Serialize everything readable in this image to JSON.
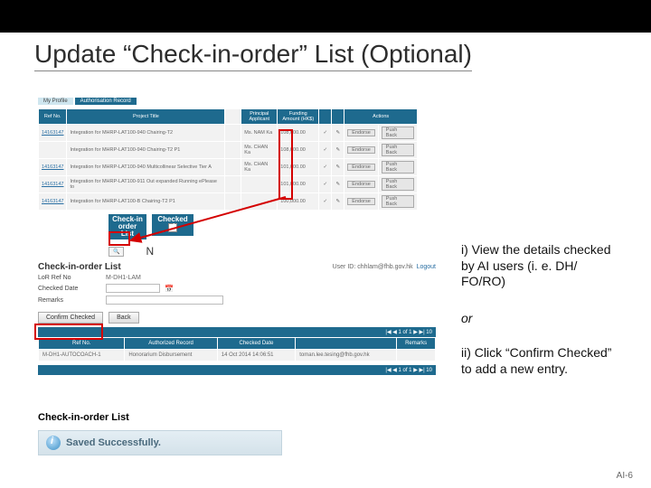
{
  "title": "Update “Check-in-order” List (Optional)",
  "app1": {
    "tabs": [
      "My Profile",
      "Authorisation Record"
    ],
    "headers": [
      "Ref No.",
      "Project Title",
      "Principal Applicant",
      "Funding Amount (HK$)",
      "",
      "",
      "Actions",
      ""
    ],
    "rows": [
      {
        "ref": "14163147",
        "title": "Integration for MHRP-LAT100-940 Chairing-T2",
        "pa": "Ms. NAM Ka",
        "amt": "108,000.00",
        "a1": "Endorse",
        "a2": "Push Back"
      },
      {
        "ref": "",
        "title": "Integration for MHRP-LAT100-940 Chairing-T2 P1",
        "pa": "Ms. CHAN Ka",
        "amt": "108,000.00",
        "a1": "Endorse",
        "a2": "Push Back"
      },
      {
        "ref": "14163147",
        "title": "Integration for MHRP-LAT100-940 Multicollinear Selective Tier A",
        "pa": "Ms. CHAN Ka",
        "amt": "101,000.00",
        "a1": "Endorse",
        "a2": "Push Back"
      },
      {
        "ref": "14163147",
        "title": "Integration for MHRP-LAT100-911 Out expanded Running ePlease to",
        "pa": "",
        "amt": "101,000.00",
        "a1": "Endorse",
        "a2": "Push Back"
      },
      {
        "ref": "14163147",
        "title": "Integration for MHRP-LAT100-B Chairing-T2 P1",
        "pa": "",
        "amt": "100,000.00",
        "a1": "Endorse",
        "a2": "Push Back"
      }
    ],
    "checkin_label": "Check-in order List",
    "checked_label": "Checked",
    "magnify": "🔍",
    "N": "N"
  },
  "app2": {
    "heading": "Check-in-order List",
    "user_prefix": "User ID:",
    "user": "chhlam@fhb.gov.hk",
    "logout": "Logout",
    "lbl_ref": "LoR Ref No",
    "val_ref": "M-DH1-LAM",
    "lbl_date": "Checked Date",
    "lbl_remarks": "Remarks",
    "btn_confirm": "Confirm Checked",
    "btn_back": "Back",
    "pager": "|◀ ◀   1 of 1   ▶ ▶|     10",
    "headers": [
      "Ref No.",
      "Authorized Record",
      "Checked Date",
      "",
      "Remarks"
    ],
    "row": {
      "ref": "M-DH1-AUTOCOACH-1",
      "auth": "Honorarium Disbursement",
      "date": "14 Oct 2014 14:06:51",
      "by": "toman.lee.tesing@fhb.gov.hk",
      "rem": ""
    }
  },
  "app3": {
    "heading": "Check-in-order List",
    "saved": "Saved Successfully."
  },
  "instr": {
    "i1": "i) View the details checked by AI users (i. e. DH/ FO/RO)",
    "or": "or",
    "i2": "ii) Click “Confirm Checked” to add a new entry."
  },
  "page": "AI-6"
}
